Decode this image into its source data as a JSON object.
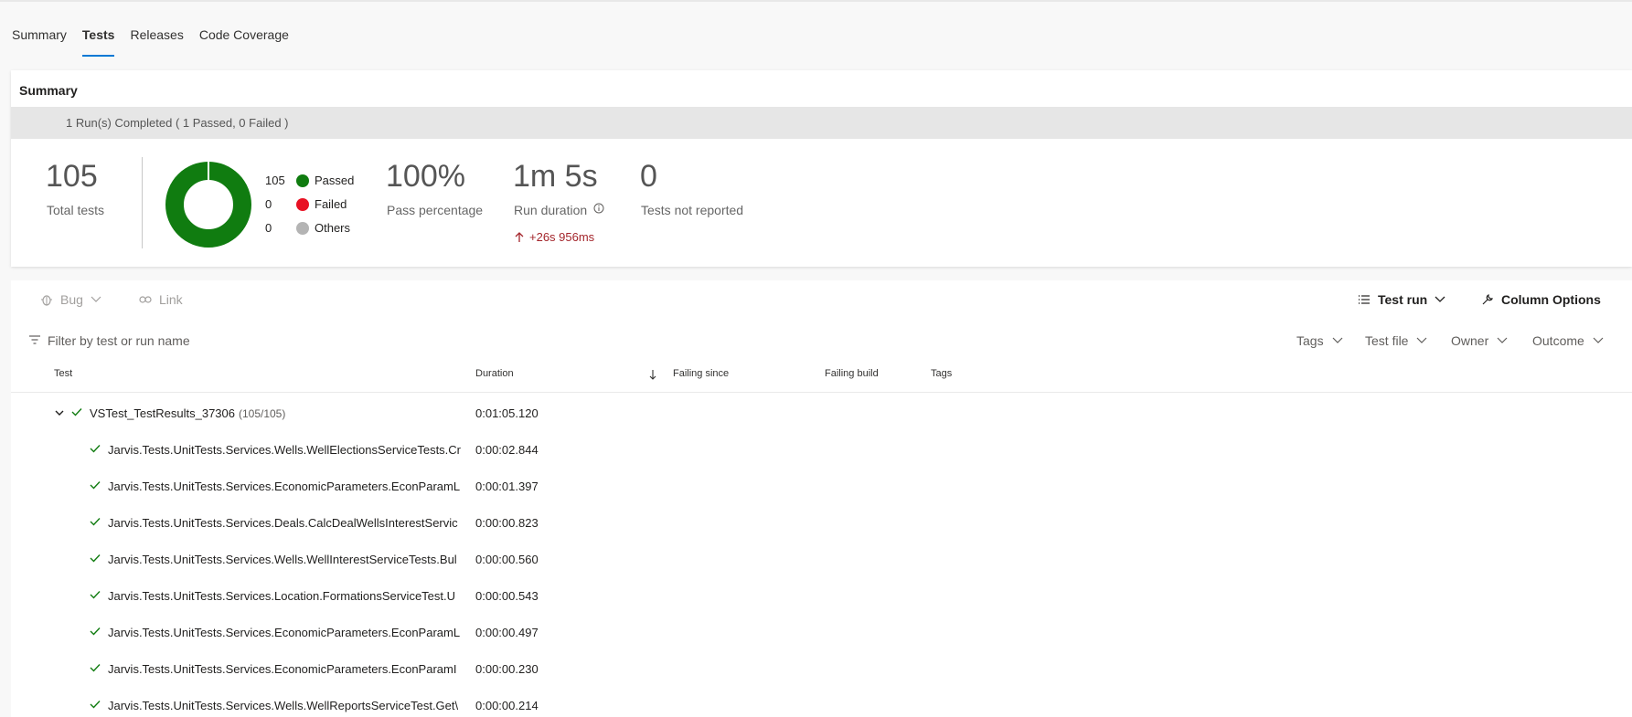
{
  "tabs": [
    {
      "label": "Summary",
      "active": false
    },
    {
      "label": "Tests",
      "active": true
    },
    {
      "label": "Releases",
      "active": false
    },
    {
      "label": "Code Coverage",
      "active": false
    }
  ],
  "summary": {
    "title": "Summary",
    "run_status": "1 Run(s) Completed ( 1 Passed, 0 Failed )",
    "total_tests": "105",
    "total_tests_label": "Total tests",
    "legend": [
      {
        "count": "105",
        "label": "Passed",
        "color": "#107c10"
      },
      {
        "count": "0",
        "label": "Failed",
        "color": "#e81123"
      },
      {
        "count": "0",
        "label": "Others",
        "color": "#b4b4b4"
      }
    ],
    "donut": {
      "passed": 105,
      "failed": 0,
      "others": 0,
      "total": 105
    },
    "pass_percentage": "100%",
    "pass_percentage_label": "Pass percentage",
    "run_duration": "1m 5s",
    "run_duration_label": "Run duration",
    "run_duration_delta": "+26s 956ms",
    "not_reported": "0",
    "not_reported_label": "Tests not reported"
  },
  "toolbar": {
    "bug_label": "Bug",
    "link_label": "Link",
    "test_run_label": "Test run",
    "column_options_label": "Column Options"
  },
  "filter": {
    "placeholder": "Filter by test or run name",
    "dropdowns": [
      "Tags",
      "Test file",
      "Owner",
      "Outcome"
    ]
  },
  "columns": {
    "test": "Test",
    "duration": "Duration",
    "failing_since": "Failing since",
    "failing_build": "Failing build",
    "tags": "Tags"
  },
  "run": {
    "name": "VSTest_TestResults_37306",
    "count": "(105/105)",
    "duration": "0:01:05.120"
  },
  "rows": [
    {
      "name": "Jarvis.Tests.UnitTests.Services.Wells.WellElectionsServiceTests.Cr",
      "duration": "0:00:02.844"
    },
    {
      "name": "Jarvis.Tests.UnitTests.Services.EconomicParameters.EconParamL",
      "duration": "0:00:01.397"
    },
    {
      "name": "Jarvis.Tests.UnitTests.Services.Deals.CalcDealWellsInterestServic",
      "duration": "0:00:00.823"
    },
    {
      "name": "Jarvis.Tests.UnitTests.Services.Wells.WellInterestServiceTests.Bul",
      "duration": "0:00:00.560"
    },
    {
      "name": "Jarvis.Tests.UnitTests.Services.Location.FormationsServiceTest.U",
      "duration": "0:00:00.543"
    },
    {
      "name": "Jarvis.Tests.UnitTests.Services.EconomicParameters.EconParamL",
      "duration": "0:00:00.497"
    },
    {
      "name": "Jarvis.Tests.UnitTests.Services.EconomicParameters.EconParamI",
      "duration": "0:00:00.230"
    },
    {
      "name": "Jarvis.Tests.UnitTests.Services.Wells.WellReportsServiceTest.Get\\",
      "duration": "0:00:00.214"
    }
  ]
}
